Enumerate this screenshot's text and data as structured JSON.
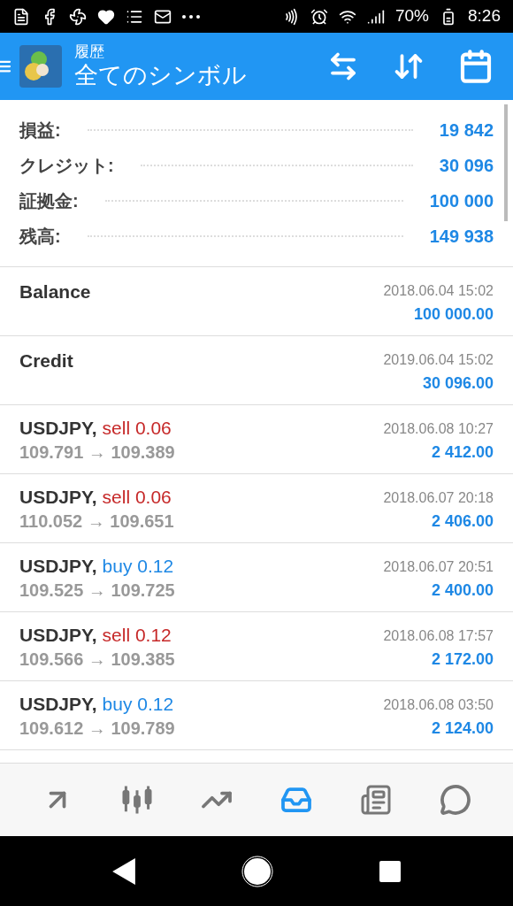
{
  "status_bar": {
    "battery": "70%",
    "time": "8:26"
  },
  "header": {
    "subtitle": "履歴",
    "title": "全てのシンボル"
  },
  "summary": [
    {
      "label": "損益:",
      "value": "19 842"
    },
    {
      "label": "クレジット:",
      "value": "30 096"
    },
    {
      "label": "証拠金:",
      "value": "100 000"
    },
    {
      "label": "残高:",
      "value": "149 938"
    }
  ],
  "history": [
    {
      "kind": "deposit",
      "title": "Balance",
      "time": "2018.06.04 15:02",
      "amount": "100 000.00"
    },
    {
      "kind": "deposit",
      "title": "Credit",
      "time": "2019.06.04 15:02",
      "amount": "30 096.00"
    },
    {
      "kind": "trade",
      "symbol": "USDJPY,",
      "order": "sell 0.06",
      "color": "#c62828",
      "prices": "109.791 → 109.389",
      "time": "2018.06.08 10:27",
      "amount": "2 412.00"
    },
    {
      "kind": "trade",
      "symbol": "USDJPY,",
      "order": "sell 0.06",
      "color": "#c62828",
      "prices": "110.052 → 109.651",
      "time": "2018.06.07 20:18",
      "amount": "2 406.00"
    },
    {
      "kind": "trade",
      "symbol": "USDJPY,",
      "order": "buy 0.12",
      "color": "#1e88e5",
      "prices": "109.525 → 109.725",
      "time": "2018.06.07 20:51",
      "amount": "2 400.00"
    },
    {
      "kind": "trade",
      "symbol": "USDJPY,",
      "order": "sell 0.12",
      "color": "#c62828",
      "prices": "109.566 → 109.385",
      "time": "2018.06.08 17:57",
      "amount": "2 172.00"
    },
    {
      "kind": "trade",
      "symbol": "USDJPY,",
      "order": "buy 0.12",
      "color": "#1e88e5",
      "prices": "109.612 → 109.789",
      "time": "2018.06.08 03:50",
      "amount": "2 124.00"
    }
  ],
  "bottom_tabs": [
    {
      "kind": "quotes",
      "selected": false
    },
    {
      "kind": "chart",
      "selected": false
    },
    {
      "kind": "trade",
      "selected": false
    },
    {
      "kind": "history",
      "selected": true
    },
    {
      "kind": "news",
      "selected": false
    },
    {
      "kind": "chat",
      "selected": false
    }
  ]
}
